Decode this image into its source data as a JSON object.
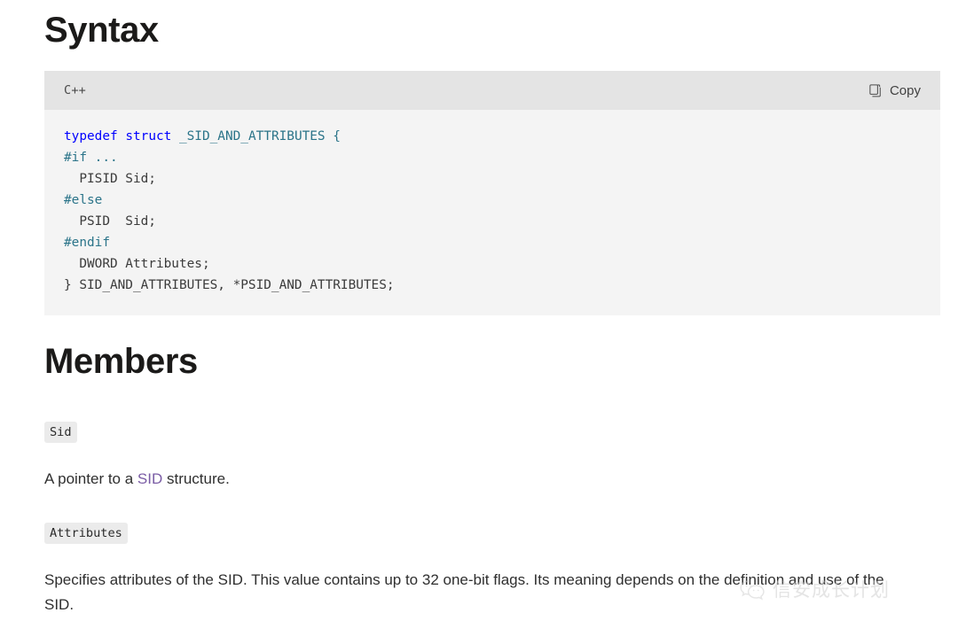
{
  "sections": {
    "syntax_heading": "Syntax",
    "members_heading": "Members"
  },
  "code_block": {
    "language_label": "C++",
    "copy_label": "Copy",
    "copy_icon": "copy-icon",
    "lines": [
      "typedef struct _SID_AND_ATTRIBUTES {",
      "#if ...",
      "  PISID Sid;",
      "#else",
      "  PSID  Sid;",
      "#endif",
      "  DWORD Attributes;",
      "} SID_AND_ATTRIBUTES, *PSID_AND_ATTRIBUTES;"
    ],
    "tokens": {
      "typedef": "typedef",
      "struct": "struct",
      "struct_name": "_SID_AND_ATTRIBUTES {",
      "pp_if": "#if ...",
      "line_pisid": "  PISID Sid;",
      "pp_else": "#else",
      "line_psid": "  PSID  Sid;",
      "pp_endif": "#endif",
      "line_dword": "  DWORD Attributes;",
      "line_close": "} SID_AND_ATTRIBUTES, *PSID_AND_ATTRIBUTES;"
    }
  },
  "members": [
    {
      "name": "Sid",
      "desc_before": "A pointer to a ",
      "desc_link": "SID",
      "desc_after": " structure."
    },
    {
      "name": "Attributes",
      "desc_full": "Specifies attributes of the SID. This value contains up to 32 one-bit flags. Its meaning depends on the definition and use of the SID."
    }
  ],
  "watermark": {
    "text": "信安成长计划",
    "icon": "wechat-icon"
  },
  "colors": {
    "keyword_blue": "#0000ff",
    "type_teal": "#2b7489",
    "link_purple": "#7a5ca5",
    "code_bg": "#f4f4f4",
    "code_header_bg": "#e4e4e4",
    "chip_bg": "#ebebeb"
  }
}
